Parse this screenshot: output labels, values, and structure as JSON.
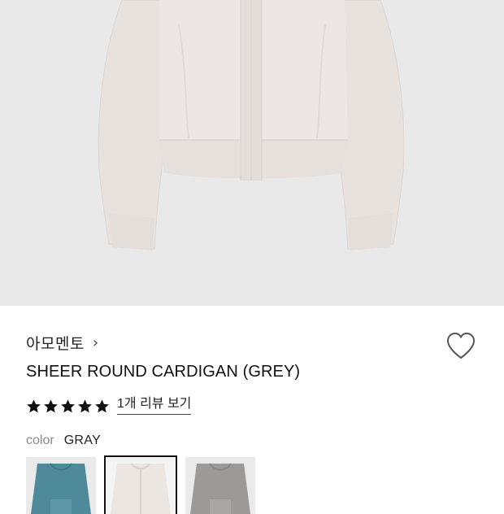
{
  "product": {
    "brand": "아모멘토",
    "brand_chevron_icon": "chevron-right-icon",
    "name": "SHEER ROUND CARDIGAN (GREY)",
    "wishlist_icon": "heart-outline-icon",
    "rating": {
      "stars": 5,
      "max_stars": 5,
      "star_icon": "star-filled-icon",
      "review_link": "1개 리뷰 보기"
    },
    "color": {
      "label": "color",
      "selected": "GRAY"
    },
    "swatches": [
      {
        "color": "#4f8a9a",
        "selected": false
      },
      {
        "color": "#ece6e2",
        "selected": true
      },
      {
        "color": "#9c9a98",
        "selected": false
      }
    ]
  },
  "colors": {
    "hero_background": "#e9e9e9",
    "garment": "#ebe5e3",
    "star": "#111111"
  }
}
